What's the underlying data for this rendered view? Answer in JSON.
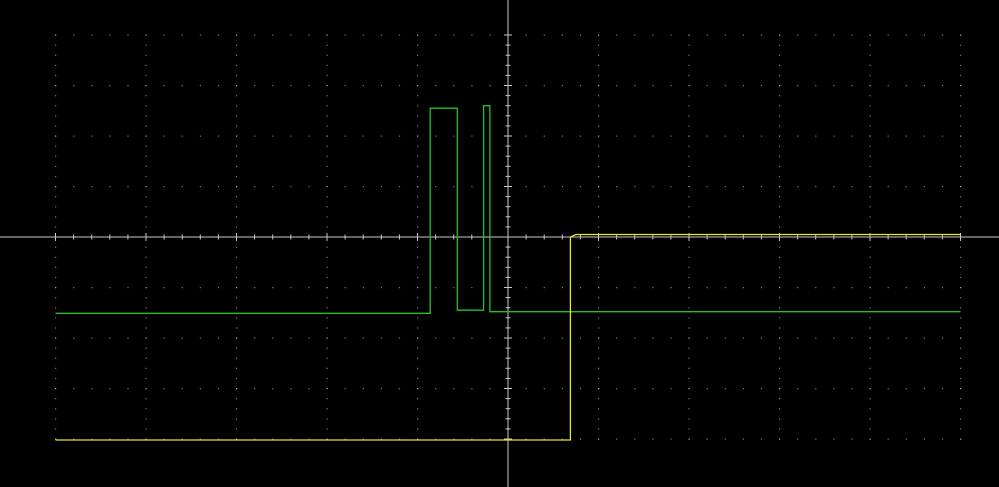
{
  "chart_data": {
    "type": "line",
    "title": "",
    "xlabel": "",
    "ylabel": "",
    "grid": true,
    "grid_divisions": {
      "x": 10,
      "y": 8
    },
    "minor_ticks_per_division": 5,
    "xlim": [
      -5,
      5
    ],
    "ylim": [
      -4,
      4
    ],
    "colors": {
      "background": "#000000",
      "graticule": "#c8c8c8",
      "ch1": "#e6e62e",
      "ch2": "#22c02a"
    },
    "series": [
      {
        "id": "ch2",
        "x": [
          -5.0,
          -0.86,
          -0.86,
          -0.8,
          -0.56,
          -0.56,
          -0.27,
          -0.27,
          -0.2,
          -0.2,
          0.0,
          5.0
        ],
        "y": [
          -1.51,
          -1.51,
          2.55,
          2.55,
          2.55,
          -1.45,
          -1.45,
          2.6,
          2.6,
          -1.48,
          -1.48,
          -1.48
        ]
      },
      {
        "id": "ch1",
        "x": [
          -5.0,
          -3.47,
          -3.2,
          -2.7,
          -0.6,
          -0.2,
          0.0,
          0.69,
          0.69,
          0.75,
          1.86,
          2.3,
          2.8,
          4.4,
          5.0
        ],
        "y": [
          -4.02,
          -4.02,
          -4.02,
          -4.02,
          -4.02,
          -4.02,
          -4.02,
          -4.02,
          0.0,
          0.05,
          0.05,
          0.05,
          0.05,
          0.05,
          0.05
        ]
      }
    ]
  }
}
